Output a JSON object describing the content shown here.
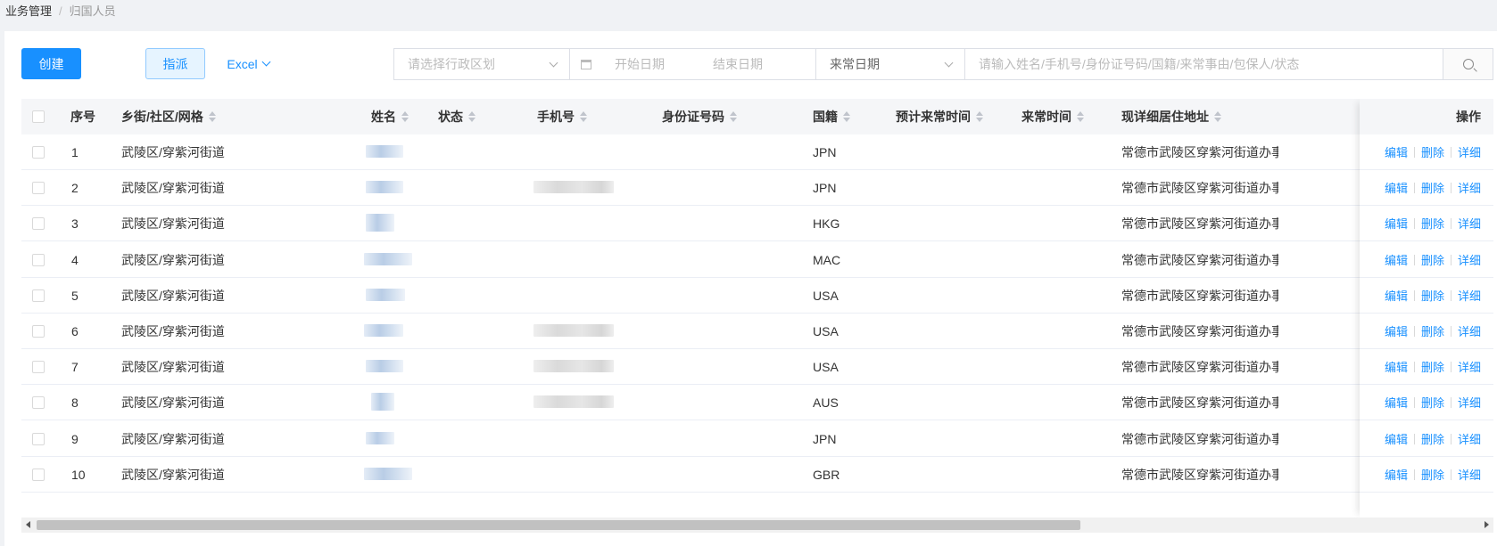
{
  "breadcrumb": {
    "first": "业务管理",
    "separator": "/",
    "current": "归国人员"
  },
  "toolbar": {
    "create_label": "创建",
    "assign_label": "指派",
    "excel_label": "Excel"
  },
  "filters": {
    "region_placeholder": "请选择行政区划",
    "start_date_placeholder": "开始日期",
    "end_date_placeholder": "结束日期",
    "date_type_value": "来常日期",
    "search_placeholder": "请输入姓名/手机号/身份证号码/国籍/来常事由/包保人/状态"
  },
  "table": {
    "columns": {
      "seq": "序号",
      "area": "乡街/社区/网格",
      "name": "姓名",
      "status": "状态",
      "phone": "手机号",
      "idcard": "身份证号码",
      "nationality": "国籍",
      "expected_time": "预计来常时间",
      "arrival_time": "来常时间",
      "address": "现详细居住地址",
      "ops": "操作"
    },
    "rows": [
      {
        "seq": "1",
        "area": "武陵区/穿紫河街道",
        "nationality": "JPN",
        "address": "常德市武陵区穿紫河街道办事处",
        "phone_blurred": false
      },
      {
        "seq": "2",
        "area": "武陵区/穿紫河街道",
        "nationality": "JPN",
        "address": "常德市武陵区穿紫河街道办事处",
        "phone_blurred": true
      },
      {
        "seq": "3",
        "area": "武陵区/穿紫河街道",
        "nationality": "HKG",
        "address": "常德市武陵区穿紫河街道办事处",
        "phone_blurred": false
      },
      {
        "seq": "4",
        "area": "武陵区/穿紫河街道",
        "nationality": "MAC",
        "address": "常德市武陵区穿紫河街道办事处",
        "phone_blurred": false
      },
      {
        "seq": "5",
        "area": "武陵区/穿紫河街道",
        "nationality": "USA",
        "address": "常德市武陵区穿紫河街道办事处",
        "phone_blurred": false
      },
      {
        "seq": "6",
        "area": "武陵区/穿紫河街道",
        "nationality": "USA",
        "address": "常德市武陵区穿紫河街道办事处",
        "phone_blurred": true
      },
      {
        "seq": "7",
        "area": "武陵区/穿紫河街道",
        "nationality": "USA",
        "address": "常德市武陵区穿紫河街道办事处",
        "phone_blurred": true
      },
      {
        "seq": "8",
        "area": "武陵区/穿紫河街道",
        "nationality": "AUS",
        "address": "常德市武陵区穿紫河街道办事处",
        "phone_blurred": true
      },
      {
        "seq": "9",
        "area": "武陵区/穿紫河街道",
        "nationality": "JPN",
        "address": "常德市武陵区穿紫河街道办事处",
        "phone_blurred": false
      },
      {
        "seq": "10",
        "area": "武陵区/穿紫河街道",
        "nationality": "GBR",
        "address": "常德市武陵区穿紫河街道办事处",
        "phone_blurred": false
      }
    ],
    "actions": {
      "edit": "编辑",
      "delete": "删除",
      "detail": "详细"
    }
  },
  "colors": {
    "primary": "#1890ff",
    "header_bg": "#f5f6f8",
    "page_bg": "#f0f2f5"
  },
  "icons": {
    "calendar": "calendar-icon",
    "search": "search-icon",
    "dropdown": "chevron-down-icon",
    "sort": "sort-icon"
  }
}
